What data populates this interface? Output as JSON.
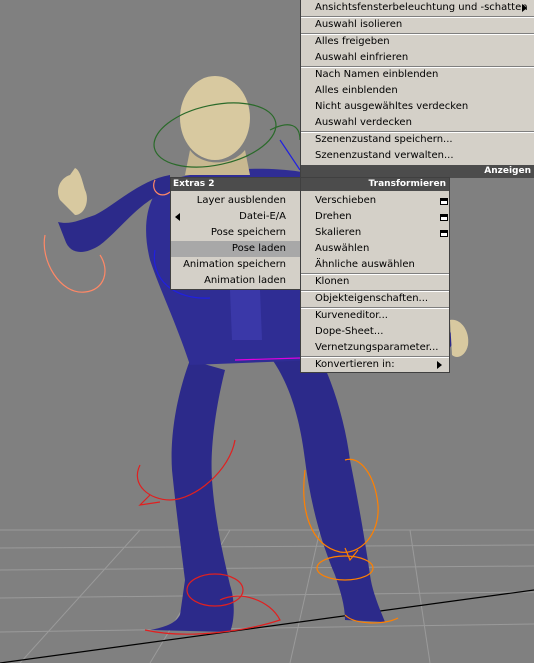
{
  "quad_menu": {
    "top_right": {
      "header": "Anzeigen",
      "items": [
        {
          "label": "Ansichtsfensterbeleuchtung und -schatten",
          "submenu": true
        },
        {
          "label": "Auswahl isolieren"
        },
        {
          "label": "Alles freigeben"
        },
        {
          "label": "Auswahl einfrieren"
        },
        {
          "label": "Nach Namen einblenden"
        },
        {
          "label": "Alles einblenden"
        },
        {
          "label": "Nicht ausgewähltes verdecken"
        },
        {
          "label": "Auswahl verdecken"
        },
        {
          "label": "Szenenzustand speichern..."
        },
        {
          "label": "Szenenzustand verwalten..."
        }
      ]
    },
    "top_left": {
      "header": "Extras 2",
      "items": [
        {
          "label": "Layer ausblenden"
        },
        {
          "label": "Datei-E/A",
          "submenu": true
        },
        {
          "label": "Pose speichern"
        },
        {
          "label": "Pose laden",
          "highlighted": true
        },
        {
          "label": "Animation speichern"
        },
        {
          "label": "Animation laden"
        }
      ]
    },
    "bottom_right": {
      "header": "Transformieren",
      "items": [
        {
          "label": "Verschieben",
          "settings_icon": true
        },
        {
          "label": "Drehen",
          "settings_icon": true
        },
        {
          "label": "Skalieren",
          "settings_icon": true
        },
        {
          "label": "Auswählen"
        },
        {
          "label": "Ähnliche auswählen"
        },
        {
          "label": "Klonen"
        },
        {
          "label": "Objekteigenschaften..."
        },
        {
          "label": "Kurveneditor..."
        },
        {
          "label": "Dope-Sheet..."
        },
        {
          "label": "Vernetzungsparameter..."
        },
        {
          "label": "Konvertieren in:",
          "submenu": true
        }
      ]
    }
  },
  "colors": {
    "viewport_bg": "#808080",
    "menu_bg": "#d4d0c8",
    "header_bg": "#4c4c4c",
    "highlight": "#a8a8a8",
    "suit": "#2c2a8a",
    "skin": "#d8c9a0",
    "rig_red": "#e02020",
    "rig_orange": "#ff8000",
    "rig_green": "#2a6a2a",
    "rig_blue": "#2020e0"
  }
}
